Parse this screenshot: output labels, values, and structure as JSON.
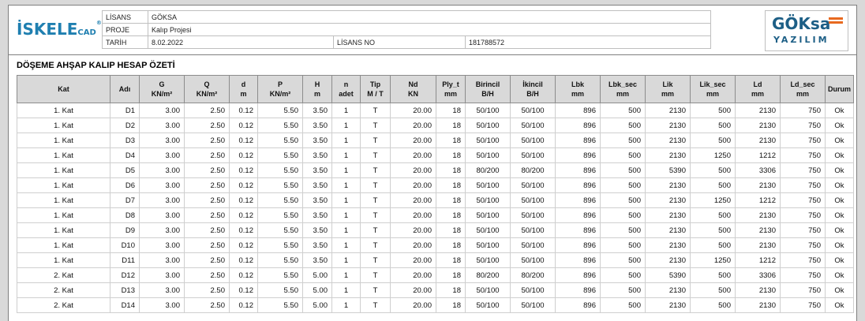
{
  "logo_left": {
    "main": "İSKELE",
    "sub": "CAD",
    "mark": "®"
  },
  "logo_right": {
    "line1": "GÖKsa",
    "line2": "YAZILIM",
    "colors": {
      "text": "#1d5f86",
      "stripes": "#e8691f"
    }
  },
  "info": {
    "lisans_label": "LİSANS",
    "lisans_value": "GÖKSA",
    "proje_label": "PROJE",
    "proje_value": "Kalıp Projesi",
    "tarih_label": "TARİH",
    "tarih_value": "8.02.2022",
    "lisans_no_label": "LİSANS NO",
    "lisans_no_value": "181788572"
  },
  "title": "DÖŞEME AHŞAP KALIP HESAP ÖZETİ",
  "table": {
    "headers": [
      {
        "l1": "Kat",
        "l2": ""
      },
      {
        "l1": "Adı",
        "l2": ""
      },
      {
        "l1": "G",
        "l2": "KN/m²"
      },
      {
        "l1": "Q",
        "l2": "KN/m²"
      },
      {
        "l1": "d",
        "l2": "m"
      },
      {
        "l1": "P",
        "l2": "KN/m²"
      },
      {
        "l1": "H",
        "l2": "m"
      },
      {
        "l1": "n",
        "l2": "adet"
      },
      {
        "l1": "Tip",
        "l2": "M / T"
      },
      {
        "l1": "Nd",
        "l2": "KN"
      },
      {
        "l1": "Ply_t",
        "l2": "mm"
      },
      {
        "l1": "Birincil",
        "l2": "B/H"
      },
      {
        "l1": "İkincil",
        "l2": "B/H"
      },
      {
        "l1": "Lbk",
        "l2": "mm"
      },
      {
        "l1": "Lbk_sec",
        "l2": "mm"
      },
      {
        "l1": "Lik",
        "l2": "mm"
      },
      {
        "l1": "Lik_sec",
        "l2": "mm"
      },
      {
        "l1": "Ld",
        "l2": "mm"
      },
      {
        "l1": "Ld_sec",
        "l2": "mm"
      },
      {
        "l1": "Durum",
        "l2": ""
      }
    ],
    "rows": [
      [
        "1. Kat",
        "D1",
        "3.00",
        "2.50",
        "0.12",
        "5.50",
        "3.50",
        "1",
        "T",
        "20.00",
        "18",
        "50/100",
        "50/100",
        "896",
        "500",
        "2130",
        "500",
        "2130",
        "750",
        "Ok"
      ],
      [
        "1. Kat",
        "D2",
        "3.00",
        "2.50",
        "0.12",
        "5.50",
        "3.50",
        "1",
        "T",
        "20.00",
        "18",
        "50/100",
        "50/100",
        "896",
        "500",
        "2130",
        "500",
        "2130",
        "750",
        "Ok"
      ],
      [
        "1. Kat",
        "D3",
        "3.00",
        "2.50",
        "0.12",
        "5.50",
        "3.50",
        "1",
        "T",
        "20.00",
        "18",
        "50/100",
        "50/100",
        "896",
        "500",
        "2130",
        "500",
        "2130",
        "750",
        "Ok"
      ],
      [
        "1. Kat",
        "D4",
        "3.00",
        "2.50",
        "0.12",
        "5.50",
        "3.50",
        "1",
        "T",
        "20.00",
        "18",
        "50/100",
        "50/100",
        "896",
        "500",
        "2130",
        "1250",
        "1212",
        "750",
        "Ok"
      ],
      [
        "1. Kat",
        "D5",
        "3.00",
        "2.50",
        "0.12",
        "5.50",
        "3.50",
        "1",
        "T",
        "20.00",
        "18",
        "80/200",
        "80/200",
        "896",
        "500",
        "5390",
        "500",
        "3306",
        "750",
        "Ok"
      ],
      [
        "1. Kat",
        "D6",
        "3.00",
        "2.50",
        "0.12",
        "5.50",
        "3.50",
        "1",
        "T",
        "20.00",
        "18",
        "50/100",
        "50/100",
        "896",
        "500",
        "2130",
        "500",
        "2130",
        "750",
        "Ok"
      ],
      [
        "1. Kat",
        "D7",
        "3.00",
        "2.50",
        "0.12",
        "5.50",
        "3.50",
        "1",
        "T",
        "20.00",
        "18",
        "50/100",
        "50/100",
        "896",
        "500",
        "2130",
        "1250",
        "1212",
        "750",
        "Ok"
      ],
      [
        "1. Kat",
        "D8",
        "3.00",
        "2.50",
        "0.12",
        "5.50",
        "3.50",
        "1",
        "T",
        "20.00",
        "18",
        "50/100",
        "50/100",
        "896",
        "500",
        "2130",
        "500",
        "2130",
        "750",
        "Ok"
      ],
      [
        "1. Kat",
        "D9",
        "3.00",
        "2.50",
        "0.12",
        "5.50",
        "3.50",
        "1",
        "T",
        "20.00",
        "18",
        "50/100",
        "50/100",
        "896",
        "500",
        "2130",
        "500",
        "2130",
        "750",
        "Ok"
      ],
      [
        "1. Kat",
        "D10",
        "3.00",
        "2.50",
        "0.12",
        "5.50",
        "3.50",
        "1",
        "T",
        "20.00",
        "18",
        "50/100",
        "50/100",
        "896",
        "500",
        "2130",
        "500",
        "2130",
        "750",
        "Ok"
      ],
      [
        "1. Kat",
        "D11",
        "3.00",
        "2.50",
        "0.12",
        "5.50",
        "3.50",
        "1",
        "T",
        "20.00",
        "18",
        "50/100",
        "50/100",
        "896",
        "500",
        "2130",
        "1250",
        "1212",
        "750",
        "Ok"
      ],
      [
        "2. Kat",
        "D12",
        "3.00",
        "2.50",
        "0.12",
        "5.50",
        "5.00",
        "1",
        "T",
        "20.00",
        "18",
        "80/200",
        "80/200",
        "896",
        "500",
        "5390",
        "500",
        "3306",
        "750",
        "Ok"
      ],
      [
        "2. Kat",
        "D13",
        "3.00",
        "2.50",
        "0.12",
        "5.50",
        "5.00",
        "1",
        "T",
        "20.00",
        "18",
        "50/100",
        "50/100",
        "896",
        "500",
        "2130",
        "500",
        "2130",
        "750",
        "Ok"
      ],
      [
        "2. Kat",
        "D14",
        "3.00",
        "2.50",
        "0.12",
        "5.50",
        "5.00",
        "1",
        "T",
        "20.00",
        "18",
        "50/100",
        "50/100",
        "896",
        "500",
        "2130",
        "500",
        "2130",
        "750",
        "Ok"
      ]
    ]
  }
}
